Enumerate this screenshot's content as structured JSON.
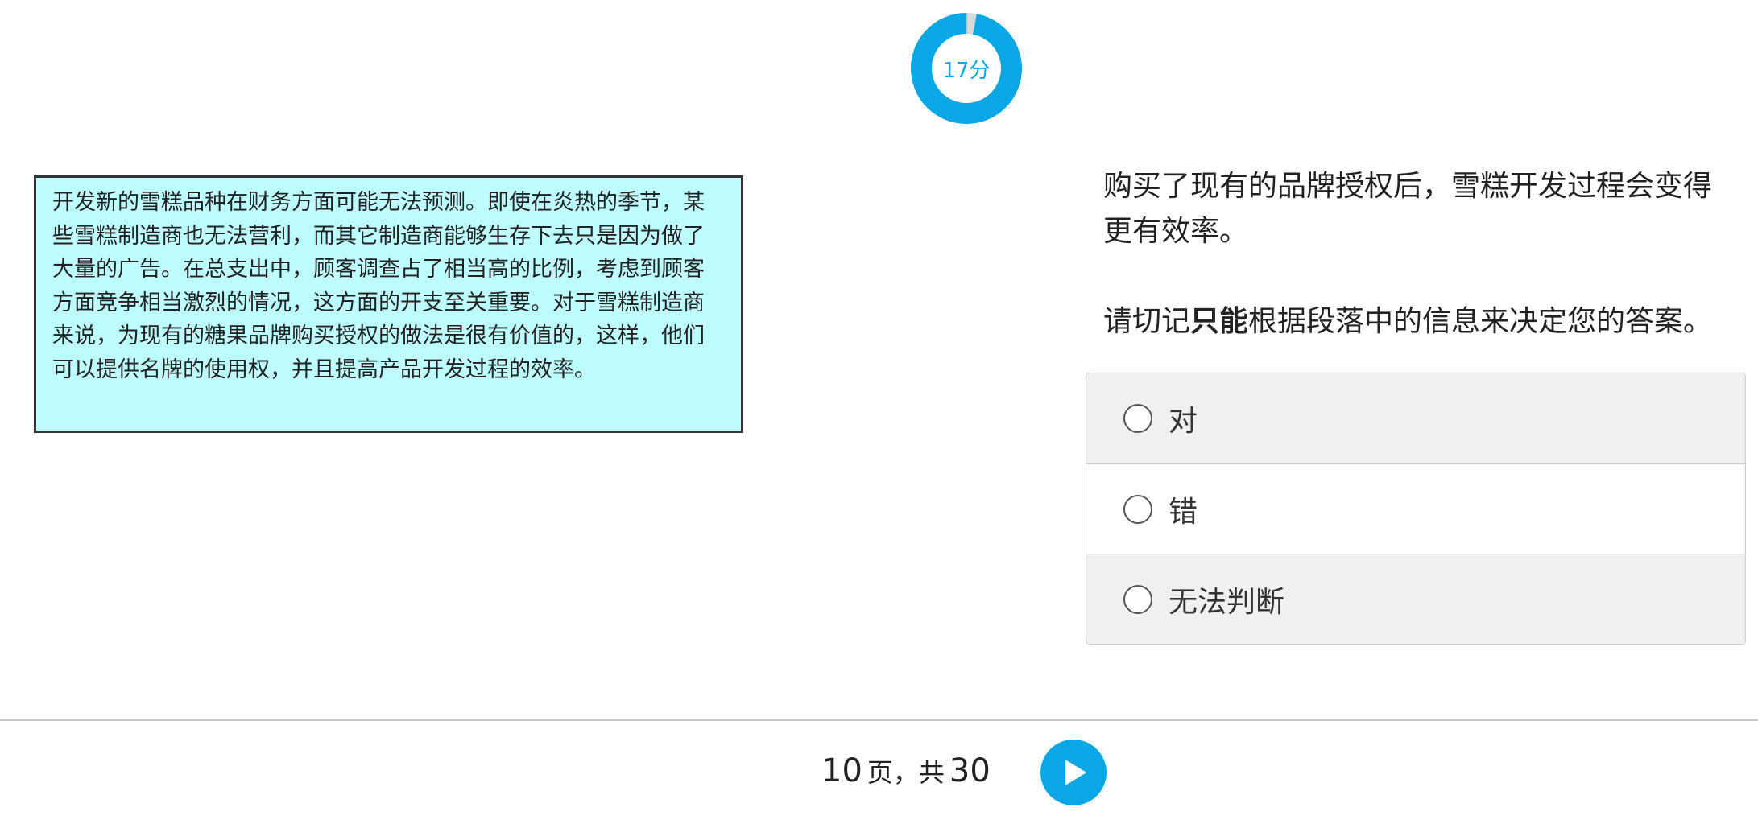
{
  "timer": {
    "label": "17分",
    "fraction_remaining": 0.97,
    "ring_color": "#0aa7e6",
    "track_color": "#d8d8d8"
  },
  "passage": {
    "text": "开发新的雪糕品种在财务方面可能无法预测。即使在炎热的季节，某些雪糕制造商也无法营利，而其它制造商能够生存下去只是因为做了大量的广告。在总支出中，顾客调查占了相当高的比例，考虑到顾客方面竞争相当激烈的情况，这方面的开支至关重要。对于雪糕制造商来说，为现有的糖果品牌购买授权的做法是很有价值的，这样，他们可以提供名牌的使用权，并且提高产品开发过程的效率。",
    "background": "#bdfdff"
  },
  "question": {
    "statement": "购买了现有的品牌授权后，雪糕开发过程会变得更有效率。",
    "instruction_pre": "请切记",
    "instruction_bold": "只能",
    "instruction_post": "根据段落中的信息来决定您的答案。"
  },
  "options": [
    {
      "label": "对"
    },
    {
      "label": "错"
    },
    {
      "label": "无法判断"
    }
  ],
  "pager": {
    "current": "10",
    "text_mid": "页，共",
    "total": "30"
  },
  "next_button": {
    "icon": "play-icon",
    "color": "#0aa7e6"
  }
}
